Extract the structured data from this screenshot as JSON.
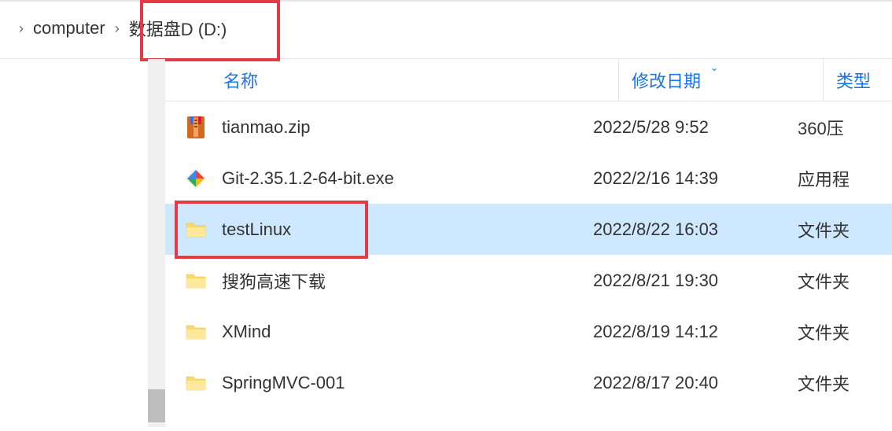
{
  "breadcrumb": {
    "items": [
      "computer",
      "数据盘D (D:)"
    ]
  },
  "columns": {
    "name": "名称",
    "date": "修改日期",
    "type": "类型"
  },
  "files": [
    {
      "icon": "zip",
      "name": "tianmao.zip",
      "date": "2022/5/28 9:52",
      "type": "360压",
      "selected": false
    },
    {
      "icon": "exe",
      "name": "Git-2.35.1.2-64-bit.exe",
      "date": "2022/2/16 14:39",
      "type": "应用程",
      "selected": false
    },
    {
      "icon": "folder",
      "name": "testLinux",
      "date": "2022/8/22 16:03",
      "type": "文件夹",
      "selected": true
    },
    {
      "icon": "folder",
      "name": "搜狗高速下载",
      "date": "2022/8/21 19:30",
      "type": "文件夹",
      "selected": false
    },
    {
      "icon": "folder",
      "name": "XMind",
      "date": "2022/8/19 14:12",
      "type": "文件夹",
      "selected": false
    },
    {
      "icon": "folder",
      "name": "SpringMVC-001",
      "date": "2022/8/17 20:40",
      "type": "文件夹",
      "selected": false
    }
  ]
}
